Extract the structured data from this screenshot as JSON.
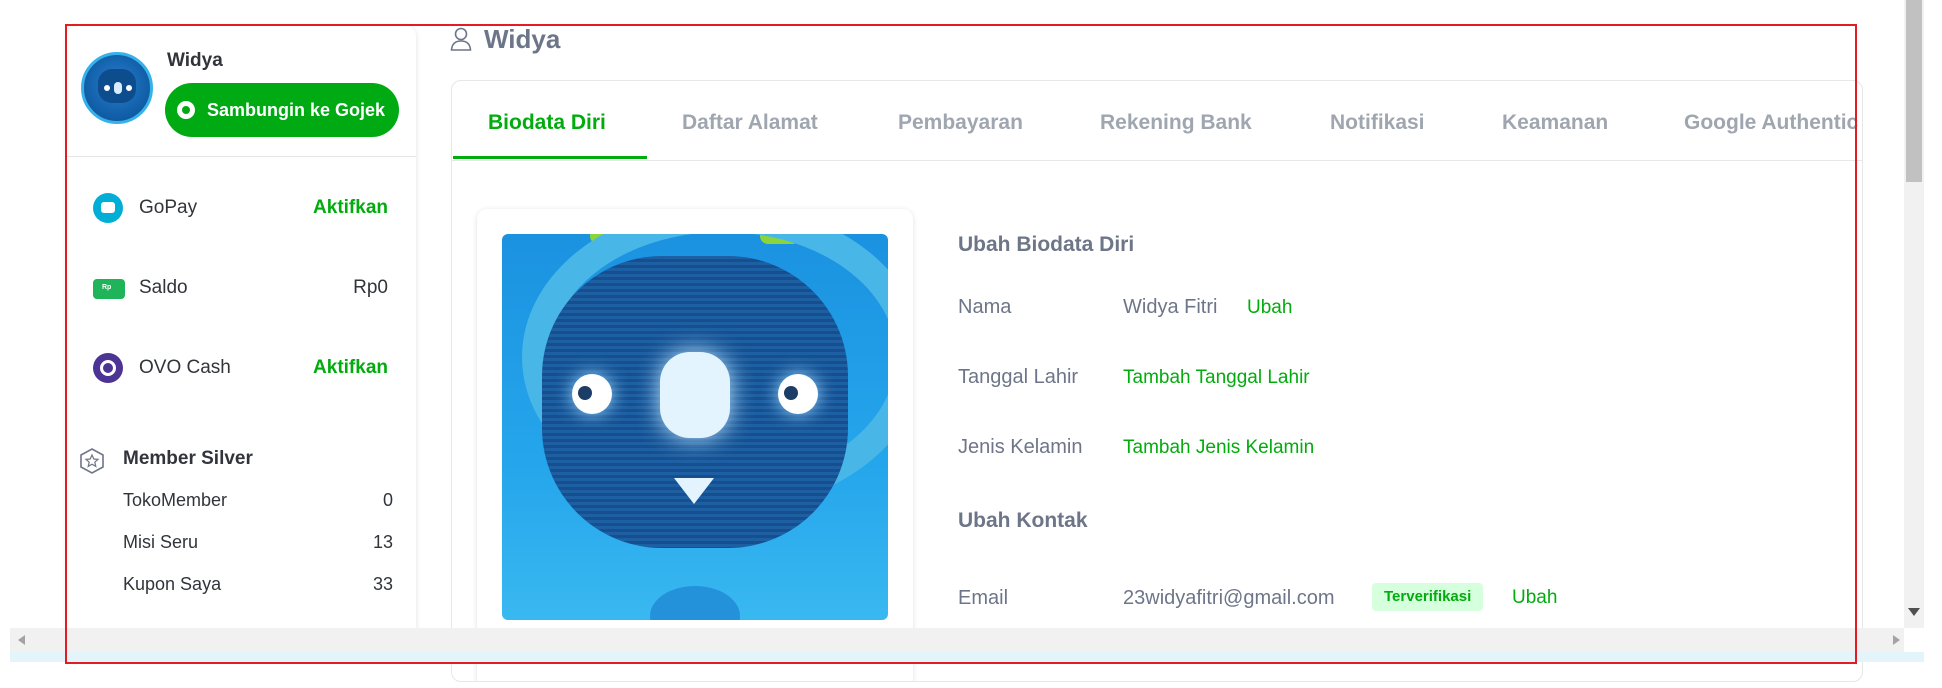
{
  "sidebar": {
    "profile_name": "Widya",
    "gojek_button": "Sambungin ke Gojek",
    "wallets": [
      {
        "icon": "gopay-icon",
        "label": "GoPay",
        "value": "Aktifkan",
        "accent": "#03ac0e"
      },
      {
        "icon": "saldo-icon",
        "label": "Saldo",
        "value": "Rp0"
      },
      {
        "icon": "ovo-icon",
        "label": "OVO Cash",
        "value": "Aktifkan",
        "accent": "#03ac0e"
      }
    ],
    "member": {
      "title": "Member Silver",
      "items": [
        {
          "label": "TokoMember",
          "value": "0"
        },
        {
          "label": "Misi Seru",
          "value": "13"
        },
        {
          "label": "Kupon Saya",
          "value": "33"
        }
      ]
    }
  },
  "page": {
    "title": "Widya",
    "tabs": [
      "Biodata Diri",
      "Daftar Alamat",
      "Pembayaran",
      "Rekening Bank",
      "Notifikasi",
      "Keamanan",
      "Google Authentic"
    ],
    "active_tab": "Biodata Diri"
  },
  "biodata": {
    "section_title": "Ubah Biodata Diri",
    "fields": [
      {
        "label": "Nama",
        "value": "Widya Fitri",
        "action": "Ubah"
      },
      {
        "label": "Tanggal Lahir",
        "action": "Tambah Tanggal Lahir"
      },
      {
        "label": "Jenis Kelamin",
        "action": "Tambah Jenis Kelamin"
      }
    ]
  },
  "kontak": {
    "section_title": "Ubah Kontak",
    "email_label": "Email",
    "email_value": "23widyafitri@gmail.com",
    "email_badge": "Terverifikasi",
    "email_action": "Ubah"
  },
  "colors": {
    "brand_green": "#03ac0e",
    "gojek_green": "#00aa13",
    "frame_red": "#e31b23"
  }
}
